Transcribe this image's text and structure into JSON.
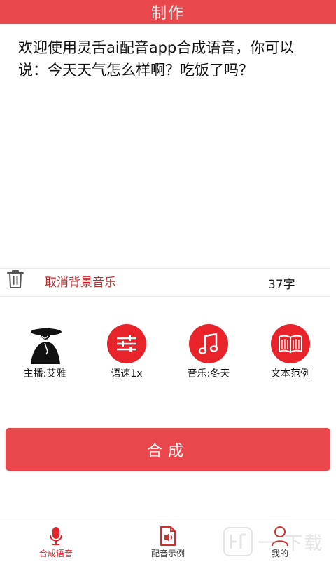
{
  "header": {
    "title": "制作"
  },
  "editor": {
    "text": "欢迎使用灵舌ai配音app合成语音，你可以说：今天天气怎么样啊？吃饭了吗？"
  },
  "toolbar": {
    "trash_icon": "trash-icon",
    "cancel_bg_music": "取消背景音乐",
    "char_count": "37字"
  },
  "options": [
    {
      "label": "主播:艾雅",
      "icon": "anchor-avatar-icon"
    },
    {
      "label": "语速1x",
      "icon": "sliders-icon"
    },
    {
      "label": "音乐:冬天",
      "icon": "music-note-icon"
    },
    {
      "label": "文本范例",
      "icon": "book-icon"
    }
  ],
  "synth_button": {
    "label": "合成"
  },
  "tabs": [
    {
      "label": "合成语音",
      "icon": "microphone-icon",
      "active": true
    },
    {
      "label": "配音示例",
      "icon": "audio-file-icon",
      "active": false
    },
    {
      "label": "我的",
      "icon": "user-icon",
      "active": false
    }
  ],
  "colors": {
    "accent": "#e8474c",
    "icon_red": "#e8232a",
    "cancel_text": "#c62828"
  }
}
